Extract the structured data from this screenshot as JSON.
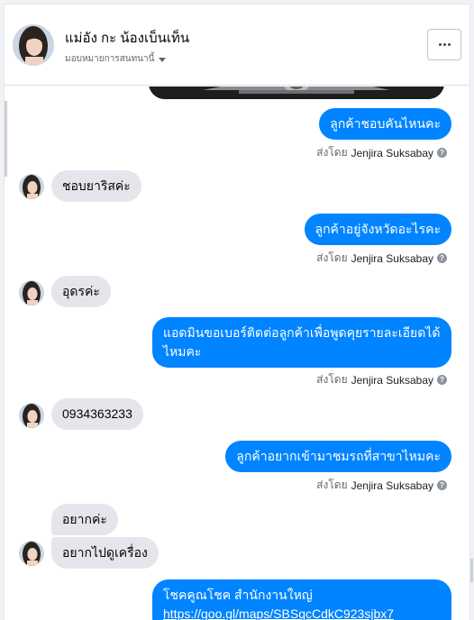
{
  "header": {
    "title": "แม่อัง กะ น้องเบ็นเท็น",
    "subtitle": "มอบหมายการสนทนานี้",
    "more_icon": "more-dots-icon"
  },
  "messages": {
    "m1": "ลูกค้าชอบคันไหนคะ",
    "m2": "ชอบยาริสค่ะ",
    "m3": "ลูกค้าอยู่จังหวัดอะไรคะ",
    "m4": "อุดรค่ะ",
    "m5": "แอดมินขอเบอร์ติดต่อลูกค้าเพื่อพูดคุยรายละเอียดได้ไหมคะ",
    "m6": "0934363233",
    "m7": "ลูกค้าอยากเข้ามาชมรถที่สาขาไหมคะ",
    "m8": "อยากค่ะ",
    "m9": "อยากไปดูเครื่อง",
    "m10_line1": "โชคคูณโชค สำนักงานใหญ่",
    "m10_link": "https://goo.gl/maps/SBSqcCdkC923sjbx7"
  },
  "sent_by": {
    "prefix": "ส่งโดย",
    "name": "Jenjira Suksabay"
  },
  "colors": {
    "outgoing_bubble": "#0084ff",
    "incoming_bubble": "#e4e6eb"
  }
}
